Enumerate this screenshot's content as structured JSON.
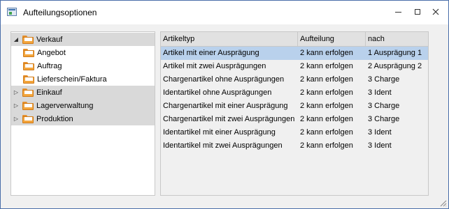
{
  "window": {
    "title": "Aufteilungsoptionen"
  },
  "tree": [
    {
      "label": "Verkauf",
      "expander": "◢",
      "parent": true
    },
    {
      "label": "Angebot",
      "expander": "",
      "parent": false
    },
    {
      "label": "Auftrag",
      "expander": "",
      "parent": false
    },
    {
      "label": "Lieferschein/Faktura",
      "expander": "",
      "parent": false
    },
    {
      "label": "Einkauf",
      "expander": "▷",
      "parent": true
    },
    {
      "label": "Lagerverwaltung",
      "expander": "▷",
      "parent": true
    },
    {
      "label": "Produktion",
      "expander": "▷",
      "parent": true
    }
  ],
  "grid": {
    "headers": [
      "Artikeltyp",
      "Aufteilung",
      "nach"
    ],
    "rows": [
      [
        "Artikel mit einer Ausprägung",
        "2 kann erfolgen",
        "1 Ausprägung 1"
      ],
      [
        "Artikel mit zwei Ausprägungen",
        "2 kann erfolgen",
        "2 Ausprägung 2"
      ],
      [
        "Chargenartikel ohne Ausprägungen",
        "2 kann erfolgen",
        "3 Charge"
      ],
      [
        "Identartikel ohne Ausprägungen",
        "2 kann erfolgen",
        "3 Ident"
      ],
      [
        "Chargenartikel mit einer Ausprägung",
        "2 kann erfolgen",
        "3 Charge"
      ],
      [
        "Chargenartikel mit zwei Ausprägungen",
        "2 kann erfolgen",
        "3 Charge"
      ],
      [
        "Identartikel mit einer Ausprägung",
        "2 kann erfolgen",
        "3 Ident"
      ],
      [
        "Identartikel mit zwei Ausprägungen",
        "2 kann erfolgen",
        "3 Ident"
      ]
    ],
    "selected_row": 0
  },
  "icons": [
    "app-icon",
    "minimize-icon",
    "maximize-icon",
    "close-icon",
    "folder-icon",
    "resize-grip-icon"
  ],
  "colors": {
    "selection": "#b9d1ec",
    "tree_parent_bg": "#d9d9d9",
    "folder": "#f3a53c",
    "border": "#4a6ea9"
  }
}
